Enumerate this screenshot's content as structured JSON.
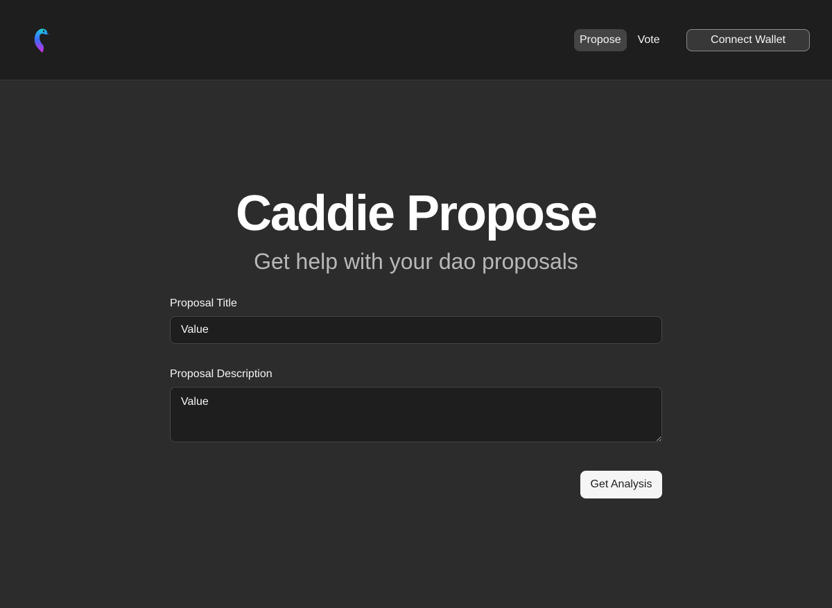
{
  "header": {
    "logo_icon": "bird-logo-icon",
    "nav": {
      "propose_label": "Propose",
      "vote_label": "Vote"
    },
    "connect_wallet_label": "Connect Wallet"
  },
  "hero": {
    "title": "Caddie Propose",
    "subtitle": "Get help with your dao proposals"
  },
  "form": {
    "title_field": {
      "label": "Proposal Title",
      "value": "Value"
    },
    "description_field": {
      "label": "Proposal Description",
      "value": "Value"
    },
    "submit_label": "Get Analysis"
  },
  "colors": {
    "page_background": "#2c2c2c",
    "header_background": "#1e1e1e",
    "input_background": "#1e1e1e",
    "active_nav_background": "#444444",
    "primary_button_background": "#f5f5f5",
    "subtitle_text": "#b8b8b8"
  }
}
